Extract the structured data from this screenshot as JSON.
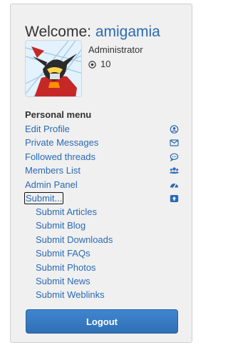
{
  "welcome": {
    "prefix": "Welcome:",
    "username": "amigamia"
  },
  "profile": {
    "role": "Administrator",
    "points": "10"
  },
  "menu": {
    "heading": "Personal menu",
    "items": [
      {
        "label": "Edit Profile",
        "icon": "user-icon"
      },
      {
        "label": "Private Messages",
        "icon": "envelope-icon"
      },
      {
        "label": "Followed threads",
        "icon": "comment-icon"
      },
      {
        "label": "Members List",
        "icon": "users-icon"
      },
      {
        "label": "Admin Panel",
        "icon": "dashboard-icon"
      },
      {
        "label": "Submit...",
        "icon": "upload-icon"
      }
    ],
    "submit_items": [
      "Submit Articles",
      "Submit Blog",
      "Submit Downloads",
      "Submit FAQs",
      "Submit Photos",
      "Submit News",
      "Submit Weblinks"
    ]
  },
  "logout_label": "Logout",
  "colors": {
    "link": "#2a6ab4",
    "button": "#3276c3",
    "panel": "#f0f0f0"
  }
}
